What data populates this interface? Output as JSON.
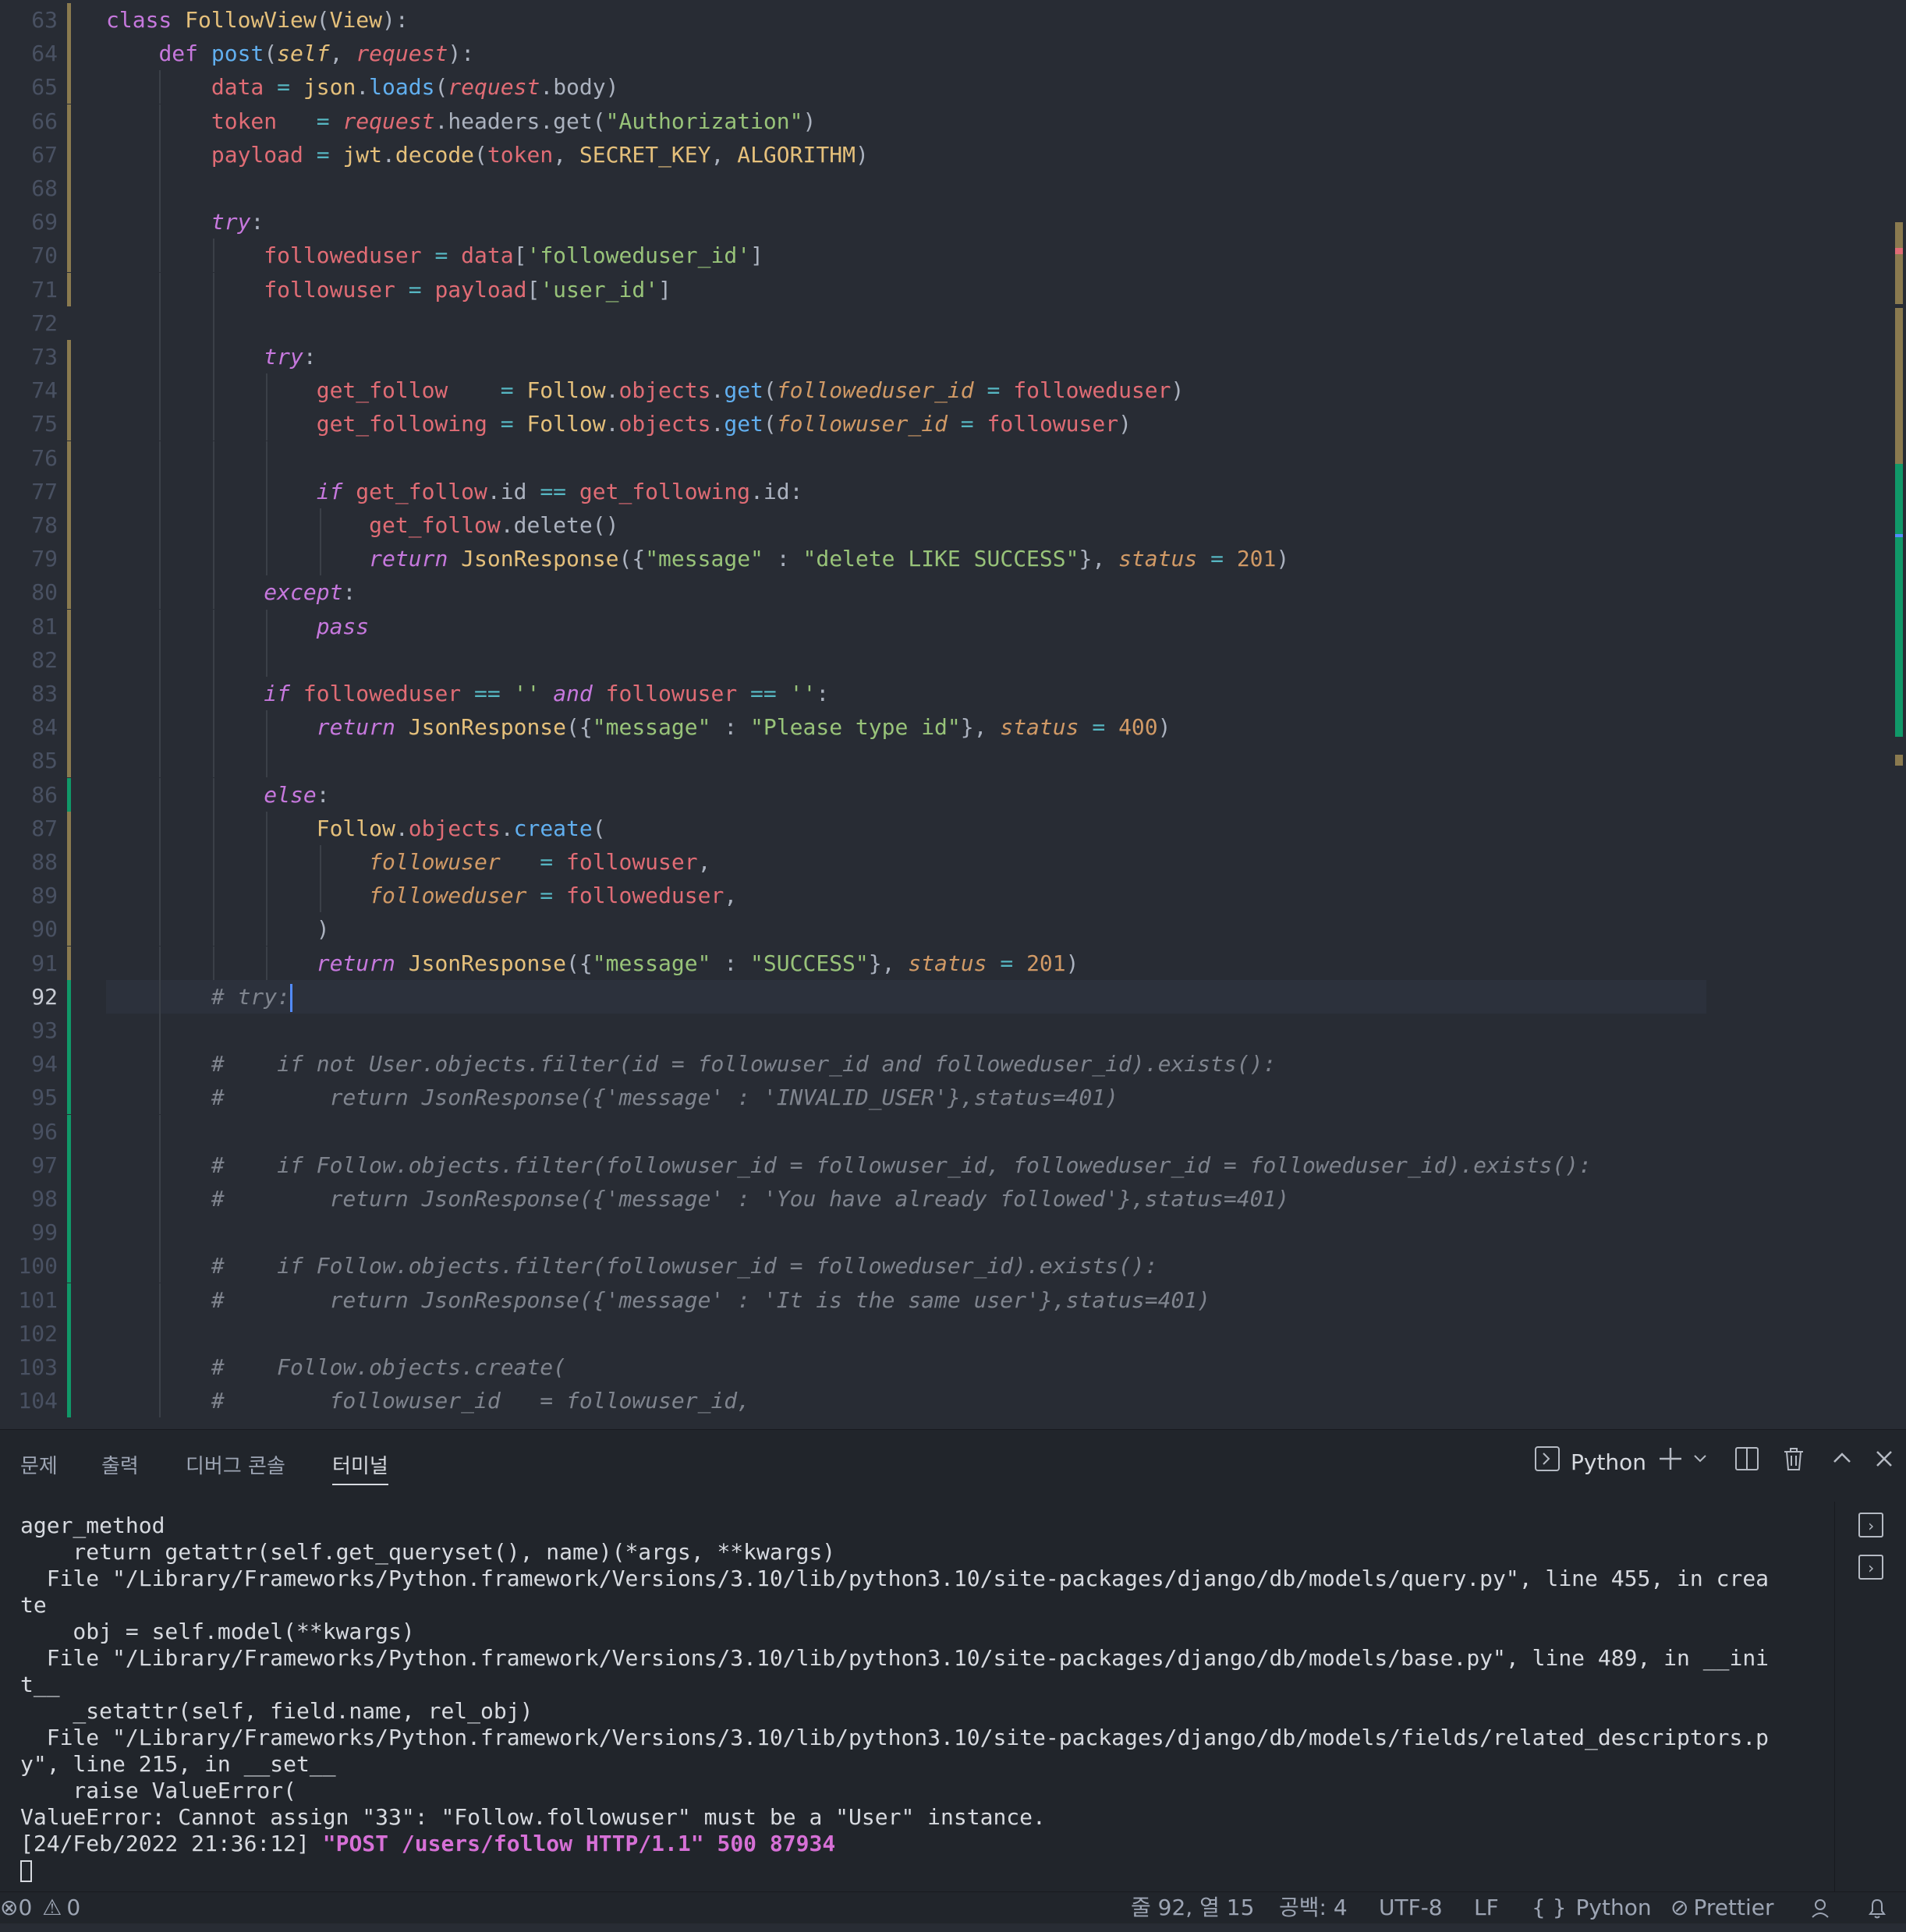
{
  "editor": {
    "current_line": 92,
    "lines": [
      {
        "n": "63",
        "tokens": [
          [
            "kw",
            "class "
          ],
          [
            "cls",
            "FollowView"
          ],
          [
            "pl",
            "("
          ],
          [
            "cls",
            "View"
          ],
          [
            "pl",
            "):"
          ]
        ]
      },
      {
        "n": "64",
        "tokens": [
          [
            "pl",
            "    "
          ],
          [
            "kw",
            "def "
          ],
          [
            "fn",
            "post"
          ],
          [
            "pl",
            "("
          ],
          [
            "self",
            "self"
          ],
          [
            "pl",
            ", "
          ],
          [
            "prm",
            "request"
          ],
          [
            "pl",
            "):"
          ]
        ]
      },
      {
        "n": "65",
        "tokens": [
          [
            "pl",
            "        "
          ],
          [
            "var",
            "data"
          ],
          [
            "op",
            " = "
          ],
          [
            "cls",
            "json"
          ],
          [
            "pl",
            "."
          ],
          [
            "fn",
            "loads"
          ],
          [
            "pl",
            "("
          ],
          [
            "prm",
            "request"
          ],
          [
            "pl",
            ".body)"
          ]
        ]
      },
      {
        "n": "66",
        "tokens": [
          [
            "pl",
            "        "
          ],
          [
            "var",
            "token"
          ],
          [
            "op",
            "   = "
          ],
          [
            "prm",
            "request"
          ],
          [
            "pl",
            ".headers.get("
          ],
          [
            "str",
            "\"Authorization\""
          ],
          [
            "pl",
            ")"
          ]
        ]
      },
      {
        "n": "67",
        "tokens": [
          [
            "pl",
            "        "
          ],
          [
            "var",
            "payload"
          ],
          [
            "op",
            " = "
          ],
          [
            "cls",
            "jwt"
          ],
          [
            "pl",
            "."
          ],
          [
            "cls",
            "decode"
          ],
          [
            "pl",
            "("
          ],
          [
            "var",
            "token"
          ],
          [
            "pl",
            ", "
          ],
          [
            "cls",
            "SECRET_KEY"
          ],
          [
            "pl",
            ", "
          ],
          [
            "cls",
            "ALGORITHM"
          ],
          [
            "pl",
            ")"
          ]
        ]
      },
      {
        "n": "68",
        "tokens": []
      },
      {
        "n": "69",
        "tokens": [
          [
            "pl",
            "        "
          ],
          [
            "kwi",
            "try"
          ],
          [
            "pl",
            ":"
          ]
        ]
      },
      {
        "n": "70",
        "tokens": [
          [
            "pl",
            "            "
          ],
          [
            "var",
            "followeduser"
          ],
          [
            "op",
            " = "
          ],
          [
            "var",
            "data"
          ],
          [
            "pl",
            "["
          ],
          [
            "str",
            "'followeduser_id'"
          ],
          [
            "pl",
            "]"
          ]
        ]
      },
      {
        "n": "71",
        "tokens": [
          [
            "pl",
            "            "
          ],
          [
            "var",
            "followuser"
          ],
          [
            "op",
            " = "
          ],
          [
            "var",
            "payload"
          ],
          [
            "pl",
            "["
          ],
          [
            "str",
            "'user_id'"
          ],
          [
            "pl",
            "]"
          ]
        ]
      },
      {
        "n": "72",
        "tokens": []
      },
      {
        "n": "73",
        "tokens": [
          [
            "pl",
            "            "
          ],
          [
            "kwi",
            "try"
          ],
          [
            "pl",
            ":"
          ]
        ]
      },
      {
        "n": "74",
        "tokens": [
          [
            "pl",
            "                "
          ],
          [
            "var",
            "get_follow"
          ],
          [
            "op",
            "    = "
          ],
          [
            "cls",
            "Follow"
          ],
          [
            "pl",
            "."
          ],
          [
            "var",
            "objects"
          ],
          [
            "pl",
            "."
          ],
          [
            "fn",
            "get"
          ],
          [
            "pl",
            "("
          ],
          [
            "kwarg",
            "followeduser_id"
          ],
          [
            "op",
            " = "
          ],
          [
            "var",
            "followeduser"
          ],
          [
            "pl",
            ")"
          ]
        ]
      },
      {
        "n": "75",
        "tokens": [
          [
            "pl",
            "                "
          ],
          [
            "var",
            "get_following"
          ],
          [
            "op",
            " = "
          ],
          [
            "cls",
            "Follow"
          ],
          [
            "pl",
            "."
          ],
          [
            "var",
            "objects"
          ],
          [
            "pl",
            "."
          ],
          [
            "fn",
            "get"
          ],
          [
            "pl",
            "("
          ],
          [
            "kwarg",
            "followuser_id"
          ],
          [
            "op",
            " = "
          ],
          [
            "var",
            "followuser"
          ],
          [
            "pl",
            ")"
          ]
        ]
      },
      {
        "n": "76",
        "tokens": []
      },
      {
        "n": "77",
        "tokens": [
          [
            "pl",
            "                "
          ],
          [
            "kwi",
            "if "
          ],
          [
            "var",
            "get_follow"
          ],
          [
            "pl",
            ".id "
          ],
          [
            "op",
            "=="
          ],
          [
            "pl",
            " "
          ],
          [
            "var",
            "get_following"
          ],
          [
            "pl",
            ".id:"
          ]
        ]
      },
      {
        "n": "78",
        "tokens": [
          [
            "pl",
            "                    "
          ],
          [
            "var",
            "get_follow"
          ],
          [
            "pl",
            ".delete()"
          ]
        ]
      },
      {
        "n": "79",
        "tokens": [
          [
            "pl",
            "                    "
          ],
          [
            "kwi",
            "return "
          ],
          [
            "cls",
            "JsonResponse"
          ],
          [
            "pl",
            "({"
          ],
          [
            "str",
            "\"message\""
          ],
          [
            "pl",
            " : "
          ],
          [
            "str",
            "\"delete LIKE SUCCESS\""
          ],
          [
            "pl",
            "}, "
          ],
          [
            "kwarg",
            "status"
          ],
          [
            "op",
            " = "
          ],
          [
            "num",
            "201"
          ],
          [
            "pl",
            ")"
          ]
        ]
      },
      {
        "n": "80",
        "tokens": [
          [
            "pl",
            "            "
          ],
          [
            "kwi",
            "except"
          ],
          [
            "pl",
            ":"
          ]
        ]
      },
      {
        "n": "81",
        "tokens": [
          [
            "pl",
            "                "
          ],
          [
            "kwi",
            "pass"
          ]
        ]
      },
      {
        "n": "82",
        "tokens": []
      },
      {
        "n": "83",
        "tokens": [
          [
            "pl",
            "            "
          ],
          [
            "kwi",
            "if "
          ],
          [
            "var",
            "followeduser"
          ],
          [
            "op",
            " == "
          ],
          [
            "str",
            "''"
          ],
          [
            "pl",
            " "
          ],
          [
            "kwi",
            "and "
          ],
          [
            "var",
            "followuser"
          ],
          [
            "op",
            " == "
          ],
          [
            "str",
            "''"
          ],
          [
            "pl",
            ":"
          ]
        ]
      },
      {
        "n": "84",
        "tokens": [
          [
            "pl",
            "                "
          ],
          [
            "kwi",
            "return "
          ],
          [
            "cls",
            "JsonResponse"
          ],
          [
            "pl",
            "({"
          ],
          [
            "str",
            "\"message\""
          ],
          [
            "pl",
            " : "
          ],
          [
            "str",
            "\"Please type id\""
          ],
          [
            "pl",
            "}, "
          ],
          [
            "kwarg",
            "status"
          ],
          [
            "op",
            " = "
          ],
          [
            "num",
            "400"
          ],
          [
            "pl",
            ")"
          ]
        ]
      },
      {
        "n": "85",
        "tokens": []
      },
      {
        "n": "86",
        "tokens": [
          [
            "pl",
            "            "
          ],
          [
            "kwi",
            "else"
          ],
          [
            "pl",
            ":"
          ]
        ]
      },
      {
        "n": "87",
        "tokens": [
          [
            "pl",
            "                "
          ],
          [
            "cls",
            "Follow"
          ],
          [
            "pl",
            "."
          ],
          [
            "var",
            "objects"
          ],
          [
            "pl",
            "."
          ],
          [
            "fn",
            "create"
          ],
          [
            "pl",
            "("
          ]
        ]
      },
      {
        "n": "88",
        "tokens": [
          [
            "pl",
            "                    "
          ],
          [
            "kwarg",
            "followuser"
          ],
          [
            "op",
            "   = "
          ],
          [
            "var",
            "followuser"
          ],
          [
            "pl",
            ","
          ]
        ]
      },
      {
        "n": "89",
        "tokens": [
          [
            "pl",
            "                    "
          ],
          [
            "kwarg",
            "followeduser"
          ],
          [
            "op",
            " = "
          ],
          [
            "var",
            "followeduser"
          ],
          [
            "pl",
            ","
          ]
        ]
      },
      {
        "n": "90",
        "tokens": [
          [
            "pl",
            "                )"
          ]
        ]
      },
      {
        "n": "91",
        "tokens": [
          [
            "pl",
            "                "
          ],
          [
            "kwi",
            "return "
          ],
          [
            "cls",
            "JsonResponse"
          ],
          [
            "pl",
            "({"
          ],
          [
            "str",
            "\"message\""
          ],
          [
            "pl",
            " : "
          ],
          [
            "str",
            "\"SUCCESS\""
          ],
          [
            "pl",
            "}, "
          ],
          [
            "kwarg",
            "status"
          ],
          [
            "op",
            " = "
          ],
          [
            "num",
            "201"
          ],
          [
            "pl",
            ")"
          ]
        ]
      },
      {
        "n": "92",
        "tokens": [
          [
            "pl",
            "        "
          ],
          [
            "cmt",
            "# try:"
          ]
        ]
      },
      {
        "n": "93",
        "tokens": []
      },
      {
        "n": "94",
        "tokens": [
          [
            "pl",
            "        "
          ],
          [
            "cmt",
            "#    if not User.objects.filter(id = followuser_id and followeduser_id).exists():"
          ]
        ]
      },
      {
        "n": "95",
        "tokens": [
          [
            "pl",
            "        "
          ],
          [
            "cmt",
            "#        return JsonResponse({'message' : 'INVALID_USER'},status=401)"
          ]
        ]
      },
      {
        "n": "96",
        "tokens": []
      },
      {
        "n": "97",
        "tokens": [
          [
            "pl",
            "        "
          ],
          [
            "cmt",
            "#    if Follow.objects.filter(followuser_id = followuser_id, followeduser_id = followeduser_id).exists():"
          ]
        ]
      },
      {
        "n": "98",
        "tokens": [
          [
            "pl",
            "        "
          ],
          [
            "cmt",
            "#        return JsonResponse({'message' : 'You have already followed'},status=401)"
          ]
        ]
      },
      {
        "n": "99",
        "tokens": []
      },
      {
        "n": "100",
        "tokens": [
          [
            "pl",
            "        "
          ],
          [
            "cmt",
            "#    if Follow.objects.filter(followuser_id = followeduser_id).exists():"
          ]
        ]
      },
      {
        "n": "101",
        "tokens": [
          [
            "pl",
            "        "
          ],
          [
            "cmt",
            "#        return JsonResponse({'message' : 'It is the same user'},status=401)"
          ]
        ]
      },
      {
        "n": "102",
        "tokens": []
      },
      {
        "n": "103",
        "tokens": [
          [
            "pl",
            "        "
          ],
          [
            "cmt",
            "#    Follow.objects.create("
          ]
        ]
      },
      {
        "n": "104",
        "tokens": [
          [
            "pl",
            "        "
          ],
          [
            "cmt",
            "#        followuser_id   = followuser_id,"
          ]
        ]
      }
    ],
    "gutter": [
      "mod",
      "mod",
      "mod",
      "mod",
      "mod",
      "mod",
      "mod",
      "mod",
      "mod",
      "none",
      "mod",
      "mod",
      "mod",
      "mod",
      "mod",
      "mod",
      "mod",
      "mod",
      "mod",
      "mod",
      "mod",
      "mod",
      "mod",
      "add",
      "mod",
      "mod",
      "mod",
      "mod",
      "mod",
      "add",
      "add",
      "add",
      "add",
      "add",
      "add",
      "add",
      "add",
      "add",
      "add",
      "add",
      "add",
      "add"
    ]
  },
  "panel": {
    "tabs": [
      "문제",
      "출력",
      "디버그 콘솔",
      "터미널"
    ],
    "active_tab": "터미널",
    "terminal_name": "Python",
    "terminal_lines": [
      "ager_method",
      "    return getattr(self.get_queryset(), name)(*args, **kwargs)",
      "  File \"/Library/Frameworks/Python.framework/Versions/3.10/lib/python3.10/site-packages/django/db/models/query.py\", line 455, in crea",
      "te",
      "    obj = self.model(**kwargs)",
      "  File \"/Library/Frameworks/Python.framework/Versions/3.10/lib/python3.10/site-packages/django/db/models/base.py\", line 489, in __ini",
      "t__",
      "    _setattr(self, field.name, rel_obj)",
      "  File \"/Library/Frameworks/Python.framework/Versions/3.10/lib/python3.10/site-packages/django/db/models/fields/related_descriptors.p",
      "y\", line 215, in __set__",
      "    raise ValueError(",
      "ValueError: Cannot assign \"33\": \"Follow.followuser\" must be a \"User\" instance."
    ],
    "log_prefix": "[24/Feb/2022 21:36:12] ",
    "log_request": "\"POST /users/follow HTTP/1.1\" 500 87934"
  },
  "status": {
    "problems": "0",
    "warnings": "0",
    "position": "줄 92, 열 15",
    "indent": "공백: 4",
    "encoding": "UTF-8",
    "eol": "LF",
    "language": "Python",
    "formatter": "Prettier"
  },
  "colors": {
    "background": "#282c34",
    "modified_gutter": "#8a7a4f",
    "added_gutter": "#109868",
    "cursor": "#528bff",
    "log_highlight": "#d670d6"
  }
}
